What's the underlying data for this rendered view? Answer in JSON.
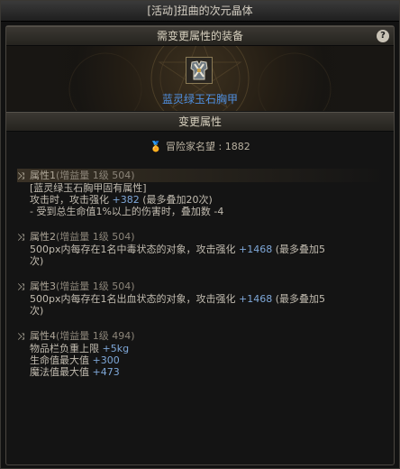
{
  "window": {
    "title": "[活动]扭曲的次元晶体"
  },
  "equip_section": {
    "header": "需变更属性的装备",
    "help": "?"
  },
  "item": {
    "name": "蓝灵绿玉石胸甲",
    "icon": "breastplate-icon"
  },
  "change_section": {
    "header": "变更属性"
  },
  "reputation": {
    "label": "冒险家名望",
    "value": "1882"
  },
  "attributes": [
    {
      "title": "属性1",
      "tag": "(增益量 1级 504)",
      "selected": true,
      "lines": [
        {
          "text": "[蓝灵绿玉石胸甲固有属性]",
          "value": ""
        },
        {
          "text": "攻击时，攻击强化 ",
          "value": "+382",
          "suffix": " (最多叠加20次)"
        },
        {
          "text": "- 受到总生命值1%以上的伤害时，叠加数 -4",
          "value": ""
        }
      ]
    },
    {
      "title": "属性2",
      "tag": "(增益量 1级 504)",
      "selected": false,
      "lines": [
        {
          "text": "500px内每存在1名中毒状态的对象，攻击强化 ",
          "value": "+1468",
          "suffix": " (最多叠加5"
        },
        {
          "text": "次)",
          "value": ""
        }
      ]
    },
    {
      "title": "属性3",
      "tag": "(增益量 1级 504)",
      "selected": false,
      "lines": [
        {
          "text": "500px内每存在1名出血状态的对象，攻击强化 ",
          "value": "+1468",
          "suffix": " (最多叠加5"
        },
        {
          "text": "次)",
          "value": ""
        }
      ]
    },
    {
      "title": "属性4",
      "tag": "(增益量 1级 494)",
      "selected": false,
      "lines": [
        {
          "text": "物品栏负重上限 ",
          "value": "+5kg"
        },
        {
          "text": "生命值最大值 ",
          "value": "+300"
        },
        {
          "text": "魔法值最大值 ",
          "value": "+473"
        }
      ]
    }
  ]
}
